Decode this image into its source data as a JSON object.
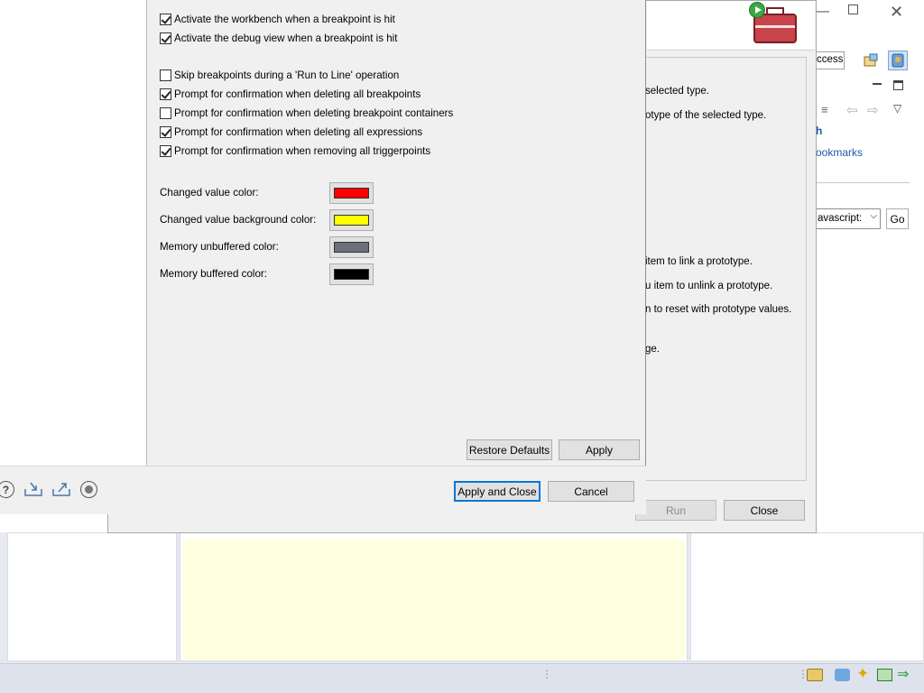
{
  "ide": {
    "right_toolbar": {
      "quick_access_text": "ccess",
      "bookmarks_link": "ookmarks",
      "search_link": "h",
      "browser_select_value": "avascript:",
      "go_button": "Go"
    },
    "colors": {
      "editor_background": "#ffffe0",
      "status_bar": "#dde2ec"
    }
  },
  "run_dialog": {
    "description_lines": [
      "selected type.",
      "otype of the selected type.",
      "item to link a prototype.",
      "u item to unlink a prototype.",
      "n to reset with prototype values.",
      "ge."
    ],
    "run_button": "Run",
    "close_button": "Close"
  },
  "preferences": {
    "checkboxes": [
      {
        "label": "Activate the workbench when a breakpoint is hit",
        "checked": true
      },
      {
        "label": "Activate the debug view when a breakpoint is hit",
        "checked": true
      },
      {
        "label": "Skip breakpoints during a 'Run to Line' operation",
        "checked": false
      },
      {
        "label": "Prompt for confirmation when deleting all breakpoints",
        "checked": true
      },
      {
        "label": "Prompt for confirmation when deleting breakpoint containers",
        "checked": false
      },
      {
        "label": "Prompt for confirmation when deleting all expressions",
        "checked": true
      },
      {
        "label": "Prompt for confirmation when removing all triggerpoints",
        "checked": true
      }
    ],
    "color_settings": [
      {
        "label": "Changed value color:",
        "color": "#ff0000"
      },
      {
        "label": "Changed value background color:",
        "color": "#ffff00"
      },
      {
        "label": "Memory unbuffered color:",
        "color": "#6d7078"
      },
      {
        "label": "Memory buffered color:",
        "color": "#000000"
      }
    ],
    "restore_defaults_button": "Restore Defaults",
    "apply_button": "Apply",
    "apply_and_close_button": "Apply and Close",
    "cancel_button": "Cancel",
    "footer_icons": [
      "help-icon",
      "import-icon",
      "export-icon",
      "record-icon"
    ]
  }
}
